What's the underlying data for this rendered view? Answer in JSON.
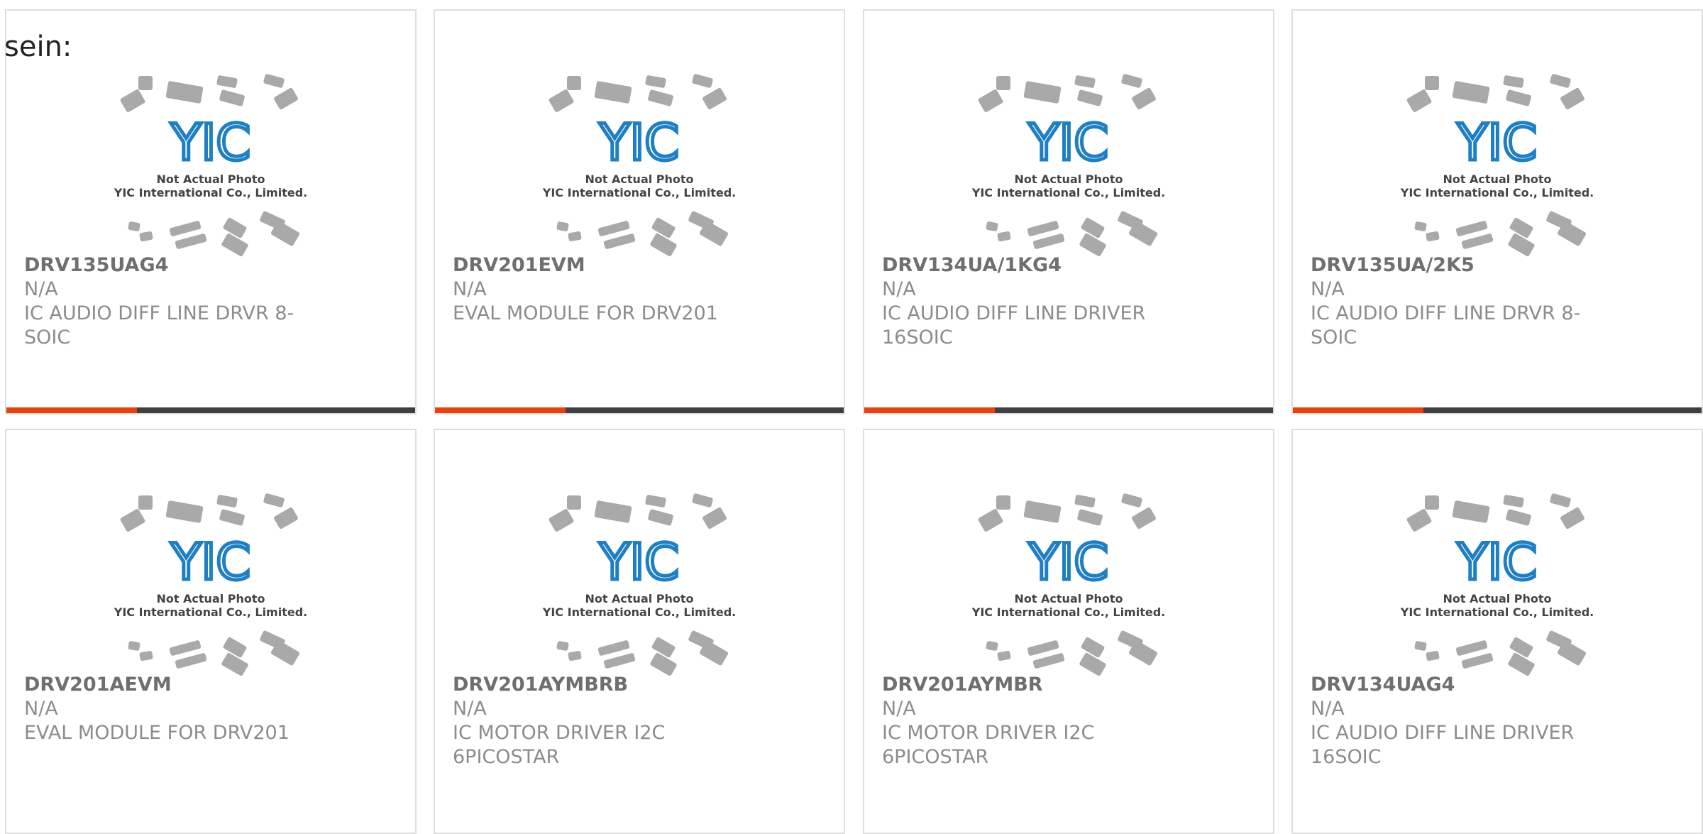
{
  "lead_text": "sein:",
  "image_caption_line1": "Not Actual Photo",
  "image_caption_line2": "YIC International Co., Limited.",
  "logo_text": "YIC",
  "colors": {
    "accent": "#e8410d",
    "bar_dark": "#3f3f3f",
    "logo_blue": "#1f7fc4",
    "chip_gray": "#a9a9a9"
  },
  "products": [
    {
      "part_number": "DRV135UAG4",
      "manufacturer": "N/A",
      "description": "IC AUDIO DIFF LINE DRVR 8-SOIC"
    },
    {
      "part_number": "DRV201EVM",
      "manufacturer": "N/A",
      "description": "EVAL MODULE FOR DRV201"
    },
    {
      "part_number": "DRV134UA/1KG4",
      "manufacturer": "N/A",
      "description": "IC AUDIO DIFF LINE DRIVER 16SOIC"
    },
    {
      "part_number": "DRV135UA/2K5",
      "manufacturer": "N/A",
      "description": "IC AUDIO DIFF LINE DRVR 8-SOIC"
    },
    {
      "part_number": "DRV201AEVM",
      "manufacturer": "N/A",
      "description": "EVAL MODULE FOR DRV201"
    },
    {
      "part_number": "DRV201AYMBRB",
      "manufacturer": "N/A",
      "description": "IC MOTOR DRIVER I2C 6PICOSTAR"
    },
    {
      "part_number": "DRV201AYMBR",
      "manufacturer": "N/A",
      "description": "IC MOTOR DRIVER I2C 6PICOSTAR"
    },
    {
      "part_number": "DRV134UAG4",
      "manufacturer": "N/A",
      "description": "IC AUDIO DIFF LINE DRIVER 16SOIC"
    }
  ]
}
